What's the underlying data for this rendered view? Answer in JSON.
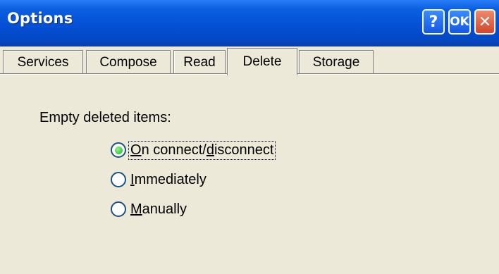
{
  "window": {
    "title": "Options",
    "help_label": "?",
    "ok_label": "OK",
    "close_label": "✕"
  },
  "tabs": [
    {
      "label": "Services",
      "selected": false
    },
    {
      "label": "Compose",
      "selected": false
    },
    {
      "label": "Read",
      "selected": false
    },
    {
      "label": "Delete",
      "selected": true
    },
    {
      "label": "Storage",
      "selected": false
    }
  ],
  "delete_tab": {
    "group_label": "Empty deleted items:",
    "options": [
      {
        "pre": "",
        "ul": "O",
        "post": "n connect/",
        "ul2": "d",
        "post2": "isconnect",
        "checked": true
      },
      {
        "pre": "",
        "ul": "I",
        "post": "mmediately",
        "checked": false
      },
      {
        "pre": "",
        "ul": "M",
        "post": "anually",
        "checked": false
      }
    ]
  },
  "colors": {
    "titlebar": "#0550d6",
    "background": "#ece9d8",
    "close_button": "#d2472a",
    "radio_checked": "#22b022"
  }
}
